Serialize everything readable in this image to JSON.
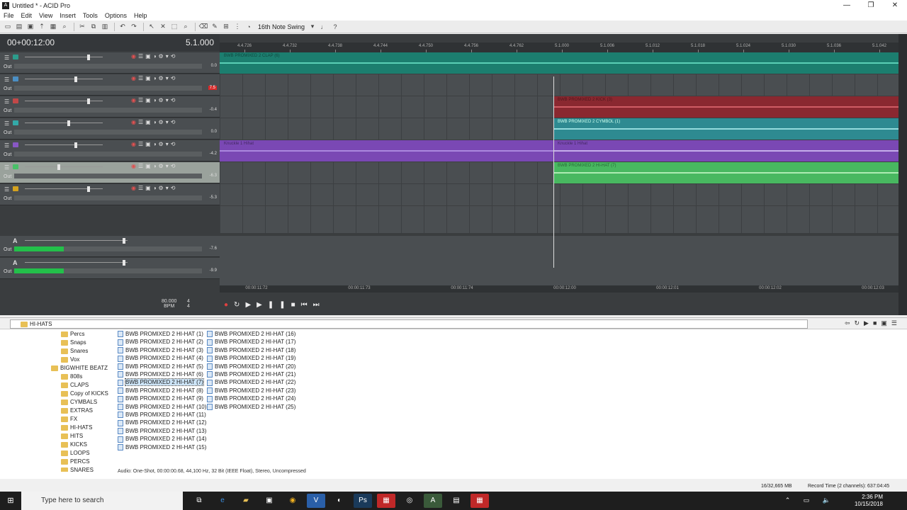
{
  "window": {
    "title": "Untitled * - ACID Pro"
  },
  "menu": [
    "File",
    "Edit",
    "View",
    "Insert",
    "Tools",
    "Options",
    "Help"
  ],
  "toolbar": {
    "swing": "16th Note Swing"
  },
  "time": {
    "timecode": "00+00:12:00",
    "beats": "5.1.000"
  },
  "ruler_ticks": [
    "4.4.726",
    "4.4.732",
    "4.4.738",
    "4.4.744",
    "4.4.750",
    "4.4.756",
    "4.4.762",
    "5.1.000",
    "5.1.006",
    "5.1.012",
    "5.1.018",
    "5.1.024",
    "5.1.030",
    "5.1.036",
    "5.1.042"
  ],
  "tracks": [
    {
      "num": "2",
      "out": "Out",
      "db": "0.0",
      "color": "#2c9c8c"
    },
    {
      "num": "3",
      "out": "Out",
      "db": "7.5",
      "color": "#4b8fc4",
      "red": true
    },
    {
      "num": "4",
      "out": "Out",
      "db": "-0.4",
      "color": "#c24848"
    },
    {
      "num": "5",
      "out": "Out",
      "db": "0.0",
      "color": "#33a9a8"
    },
    {
      "num": "6",
      "out": "Out",
      "db": "-4.2",
      "color": "#8858c4"
    },
    {
      "num": "7",
      "out": "Out",
      "db": "-6.3",
      "color": "#48c068"
    },
    {
      "num": "8",
      "out": "Out",
      "db": "-5.3",
      "color": "#d4a21e"
    }
  ],
  "clips": {
    "clap": "BWB PROMIXED 2 CLAP (6)",
    "kick": "BWB PROMIXED 2 KICK (3)",
    "cymbal": "BWB PROMIXED 2 CYMBOL (1)",
    "knuckle1": "Knuckle 1 Hihat",
    "knuckle2": "Knuckle 1 Hihat",
    "hihat": "BWB PROMIXED 2 HI-HAT (7)"
  },
  "buses": [
    {
      "out": "Out",
      "db": "-7.6",
      "sym": "A"
    },
    {
      "out": "Out",
      "db": "-9.9",
      "sym": "A"
    }
  ],
  "tc_ruler": [
    "00:00:11:72",
    "00:00:11:73",
    "00:00:11:74",
    "00:00:12:00",
    "00:00:12:01",
    "00:00:12:02",
    "00:00:12:03"
  ],
  "transport": {
    "bpm": "80.000",
    "bpm_label": "BPM",
    "sig_top": "4",
    "sig_bottom": "4"
  },
  "explorer": {
    "path": "HI-HATS",
    "tree": [
      "Percs",
      "Snaps",
      "Snares",
      "Vox",
      "BIGWHITE BEATZ",
      "808s",
      "CLAPS",
      "Copy of KICKS",
      "CYMBALS",
      "EXTRAS",
      "FX",
      "HI-HATS",
      "HITS",
      "KICKS",
      "LOOPS",
      "PERCS",
      "SNARES"
    ],
    "files_col1": [
      "BWB PROMIXED 2 HI-HAT (1)",
      "BWB PROMIXED 2 HI-HAT (2)",
      "BWB PROMIXED 2 HI-HAT (3)",
      "BWB PROMIXED 2 HI-HAT (4)",
      "BWB PROMIXED 2 HI-HAT (5)",
      "BWB PROMIXED 2 HI-HAT (6)",
      "BWB PROMIXED 2 HI-HAT (7)",
      "BWB PROMIXED 2 HI-HAT (8)",
      "BWB PROMIXED 2 HI-HAT (9)",
      "BWB PROMIXED 2 HI-HAT (10)",
      "BWB PROMIXED 2 HI-HAT (11)",
      "BWB PROMIXED 2 HI-HAT (12)",
      "BWB PROMIXED 2 HI-HAT (13)",
      "BWB PROMIXED 2 HI-HAT (14)",
      "BWB PROMIXED 2 HI-HAT (15)"
    ],
    "files_col2": [
      "BWB PROMIXED 2 HI-HAT (16)",
      "BWB PROMIXED 2 HI-HAT (17)",
      "BWB PROMIXED 2 HI-HAT (18)",
      "BWB PROMIXED 2 HI-HAT (19)",
      "BWB PROMIXED 2 HI-HAT (20)",
      "BWB PROMIXED 2 HI-HAT (21)",
      "BWB PROMIXED 2 HI-HAT (22)",
      "BWB PROMIXED 2 HI-HAT (23)",
      "BWB PROMIXED 2 HI-HAT (24)",
      "BWB PROMIXED 2 HI-HAT (25)"
    ],
    "selected": "BWB PROMIXED 2 HI-HAT (7)",
    "status": "Audio: One-Shot, 00:00:00.68, 44,100 Hz, 32 Bit (IEEE Float), Stereo, Uncompressed"
  },
  "statusbar": {
    "memory": "16/32,665 MB",
    "record": "Record Time (2 channels): 637:04:45"
  },
  "taskbar": {
    "search_placeholder": "Type here to search",
    "time": "2:36 PM",
    "date": "10/15/2018"
  }
}
